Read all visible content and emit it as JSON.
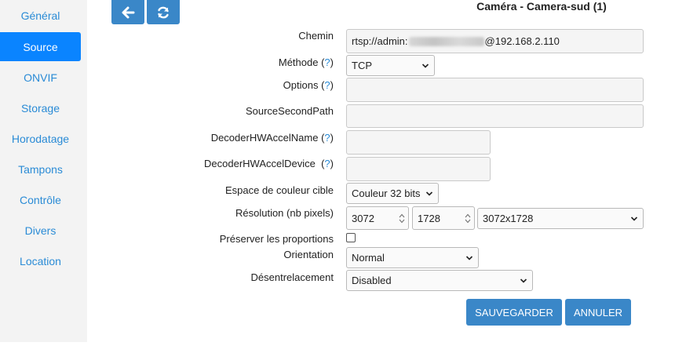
{
  "sidebar": {
    "items": [
      {
        "label": "Général"
      },
      {
        "label": "Source",
        "active": true
      },
      {
        "label": "ONVIF"
      },
      {
        "label": "Storage"
      },
      {
        "label": "Horodatage"
      },
      {
        "label": "Tampons"
      },
      {
        "label": "Contrôle"
      },
      {
        "label": "Divers"
      },
      {
        "label": "Location"
      }
    ]
  },
  "header": {
    "title": "Caméra - Camera-sud (1)",
    "back_icon": "arrow-left-icon",
    "refresh_icon": "refresh-icon"
  },
  "form": {
    "chemin": {
      "label": "Chemin",
      "value_prefix": "rtsp://admin:",
      "value_suffix": "@192.168.2.110"
    },
    "methode": {
      "label": "Méthode (",
      "help": "?",
      "close": ")",
      "value": "TCP"
    },
    "options": {
      "label": "Options (",
      "help": "?",
      "close": ")",
      "value": ""
    },
    "source_second_path": {
      "label": "SourceSecondPath",
      "value": ""
    },
    "decoder_hw_accel_name": {
      "label": "DecoderHWAccelName (",
      "help": "?",
      "close": ")",
      "value": ""
    },
    "decoder_hw_accel_device": {
      "label": "DecoderHWAccelDevice  (",
      "help": "?",
      "close": ")",
      "value": ""
    },
    "espace_couleur": {
      "label": "Espace de couleur cible",
      "value": "Couleur 32 bits"
    },
    "resolution": {
      "label": "Résolution (nb pixels)",
      "width": "3072",
      "height": "1728",
      "preset": "3072x1728"
    },
    "preserver": {
      "label": "Préserver les proportions",
      "checked": false
    },
    "orientation": {
      "label": "Orientation",
      "value": "Normal"
    },
    "desentrelacement": {
      "label": "Désentrelacement",
      "value": "Disabled"
    }
  },
  "actions": {
    "save_label": "SAUVEGARDER",
    "cancel_label": "ANNULER"
  },
  "colors": {
    "accent": "#3a87c8",
    "active_nav": "#0a84ff",
    "link": "#2a8bd6",
    "sidebar_bg": "#f3f3f3"
  }
}
